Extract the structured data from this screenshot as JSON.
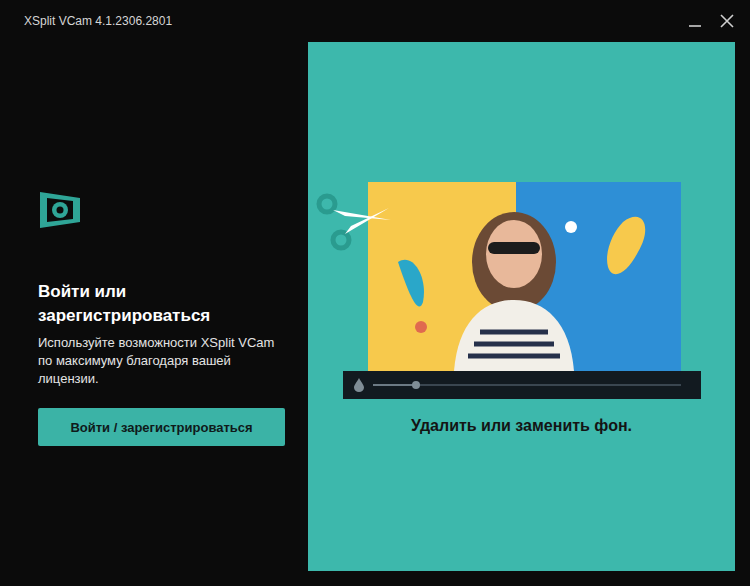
{
  "window": {
    "title": "XSplit VCam 4.1.2306.2801"
  },
  "login": {
    "heading": "Войти или зарегистрироваться",
    "description": "Используйте возможности XSplit VCam по максимуму благодаря вашей лицензии.",
    "button": "Войти / зарегистрироваться"
  },
  "feature": {
    "caption": "Удалить или заменить фон.",
    "slider": {
      "level": 0.14
    }
  }
}
